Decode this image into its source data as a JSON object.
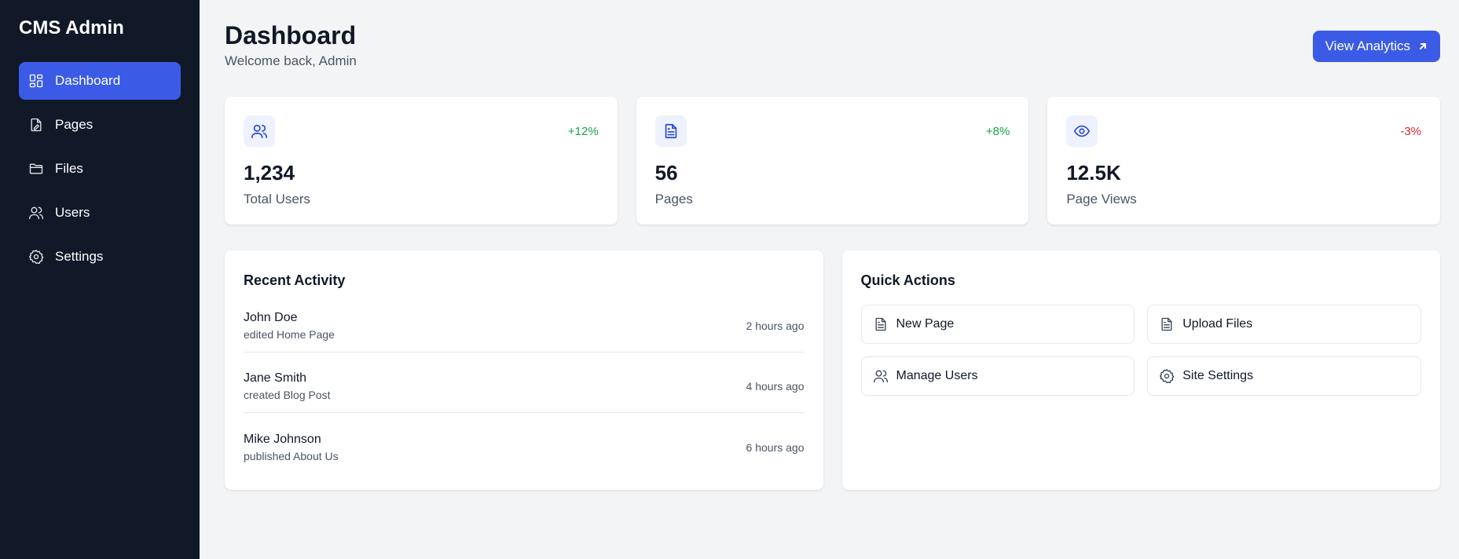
{
  "sidebar": {
    "brand": "CMS Admin",
    "items": [
      {
        "label": "Dashboard",
        "icon": "dashboard-icon",
        "active": true
      },
      {
        "label": "Pages",
        "icon": "pages-icon"
      },
      {
        "label": "Files",
        "icon": "folder-icon"
      },
      {
        "label": "Users",
        "icon": "users-icon"
      },
      {
        "label": "Settings",
        "icon": "gear-icon"
      }
    ]
  },
  "header": {
    "title": "Dashboard",
    "subtitle": "Welcome back, Admin",
    "analytics_button": "View Analytics"
  },
  "stats": [
    {
      "value": "1,234",
      "label": "Total Users",
      "change": "+12%",
      "trend": "up",
      "icon": "users-icon"
    },
    {
      "value": "56",
      "label": "Pages",
      "change": "+8%",
      "trend": "up",
      "icon": "document-icon"
    },
    {
      "value": "12.5K",
      "label": "Page Views",
      "change": "-3%",
      "trend": "down",
      "icon": "eye-icon"
    }
  ],
  "recent_activity": {
    "title": "Recent Activity",
    "items": [
      {
        "name": "John Doe",
        "action": "edited Home Page",
        "time": "2 hours ago"
      },
      {
        "name": "Jane Smith",
        "action": "created Blog Post",
        "time": "4 hours ago"
      },
      {
        "name": "Mike Johnson",
        "action": "published About Us",
        "time": "6 hours ago"
      }
    ]
  },
  "quick_actions": {
    "title": "Quick Actions",
    "items": [
      {
        "label": "New Page",
        "icon": "document-icon"
      },
      {
        "label": "Upload Files",
        "icon": "document-icon"
      },
      {
        "label": "Manage Users",
        "icon": "users-icon"
      },
      {
        "label": "Site Settings",
        "icon": "gear-icon"
      }
    ]
  },
  "colors": {
    "sidebar_bg": "#111827",
    "accent": "#3b5be7",
    "positive": "#16a34a",
    "negative": "#dc2626",
    "page_bg": "#f3f4f6"
  }
}
